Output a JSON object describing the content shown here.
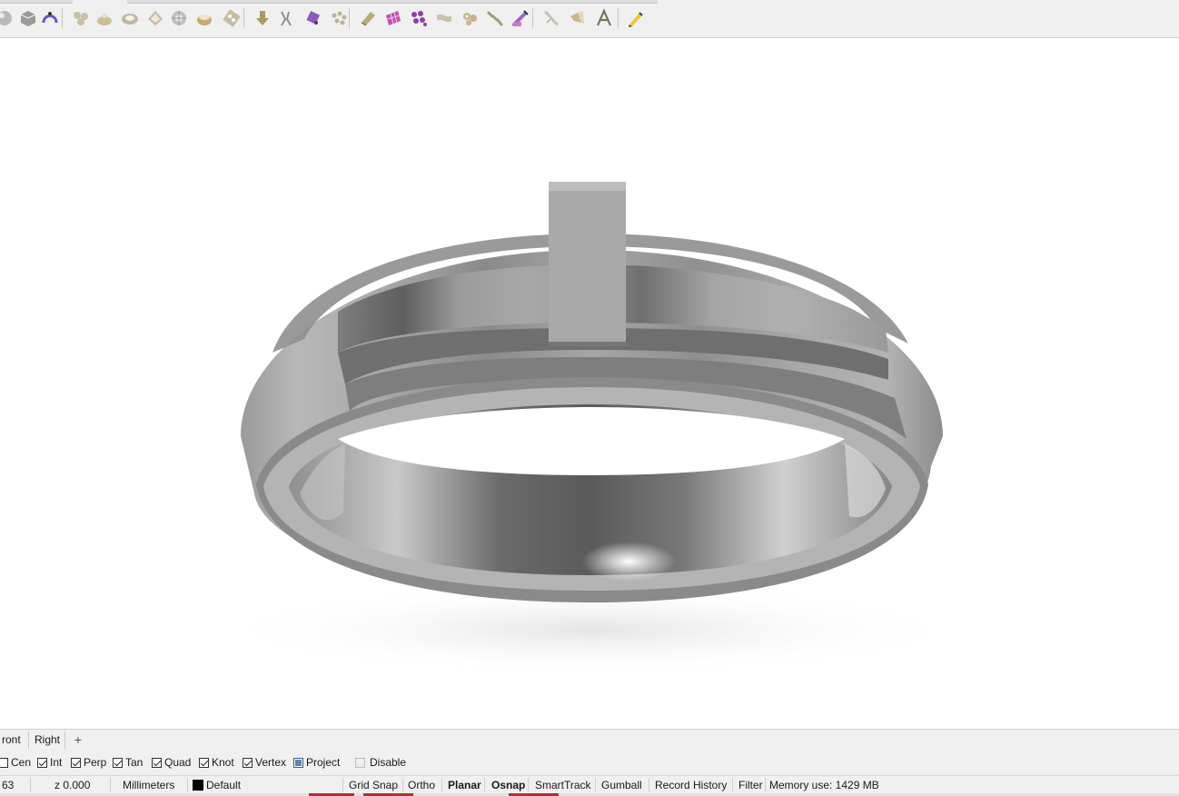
{
  "toolbar": {
    "tools": [
      {
        "icon": "sphere-partial-icon",
        "color": "#b8b8b8"
      },
      {
        "icon": "box-shade-icon",
        "color": "#9a9a9a"
      },
      {
        "icon": "bend-arc-icon",
        "color": "#6b56c8"
      },
      {
        "icon": "gem-cluster-icon",
        "color": "#c9c0a8"
      },
      {
        "icon": "ring-setting-icon",
        "color": "#cdbf94"
      },
      {
        "icon": "bezel-icon",
        "color": "#bfb6a0"
      },
      {
        "icon": "pear-gem-icon",
        "color": "#c4bba6"
      },
      {
        "icon": "round-gem-icon",
        "color": "#c0c0c0"
      },
      {
        "icon": "cup-bezel-icon",
        "color": "#c8a878"
      },
      {
        "icon": "gem-row-icon",
        "color": "#c6bc9f"
      },
      {
        "icon": "drop-arrow-icon",
        "color": "#a89a66"
      },
      {
        "icon": "claw-prong-icon",
        "color": "#8f8f8f"
      },
      {
        "icon": "cutter-icon",
        "color": "#8a5bc0"
      },
      {
        "icon": "pave-scatter-icon",
        "color": "#bcb497"
      },
      {
        "icon": "extrude-bar-icon",
        "color": "#b7aa7a"
      },
      {
        "icon": "mesh-grid-icon",
        "color": "#c050b5"
      },
      {
        "icon": "bead-grid-icon",
        "color": "#8e3fa6"
      },
      {
        "icon": "ribbon-icon",
        "color": "#c9c3ad"
      },
      {
        "icon": "gear-cluster-icon",
        "color": "#c4b58a"
      },
      {
        "icon": "chain-link-icon",
        "color": "#a59a79"
      },
      {
        "icon": "wand-purple-icon",
        "color": "#9a66c9"
      },
      {
        "icon": "loupe-curve-icon",
        "color": "#c7c1b2"
      },
      {
        "icon": "megaphone-icon",
        "color": "#c9b68a"
      },
      {
        "icon": "text-a-icon",
        "color": "#7a7360"
      },
      {
        "icon": "pencil-icon",
        "color": "#444444"
      }
    ]
  },
  "viewport": {
    "tabs": [
      "ront",
      "Right"
    ],
    "add_tab_icon": "plus-icon"
  },
  "osnap": {
    "items": [
      {
        "label": "Cen",
        "state": "unchecked"
      },
      {
        "label": "Int",
        "state": "checked"
      },
      {
        "label": "Perp",
        "state": "checked"
      },
      {
        "label": "Tan",
        "state": "checked"
      },
      {
        "label": "Quad",
        "state": "checked"
      },
      {
        "label": "Knot",
        "state": "checked"
      },
      {
        "label": "Vertex",
        "state": "checked"
      },
      {
        "label": "Project",
        "state": "filled"
      },
      {
        "label": "Disable",
        "state": "disabled"
      }
    ]
  },
  "statusbar": {
    "coord_fragment": "63",
    "z_value": "z 0.000",
    "units": "Millimeters",
    "layer": "Default",
    "layer_color": "#000000",
    "buttons": [
      {
        "label": "Grid Snap",
        "bold": false
      },
      {
        "label": "Ortho",
        "bold": false
      },
      {
        "label": "Planar",
        "bold": true
      },
      {
        "label": "Osnap",
        "bold": true
      },
      {
        "label": "SmartTrack",
        "bold": false
      },
      {
        "label": "Gumball",
        "bold": false
      },
      {
        "label": "Record History",
        "bold": false
      },
      {
        "label": "Filter",
        "bold": false
      }
    ],
    "memory": "Memory use: 1429 MB"
  },
  "colors": {
    "chrome_bg": "#f0f0f0",
    "viewport_bg": "#ffffff",
    "ring_metal": "#9c9c9c",
    "taskbar_accent": "#b5302a"
  }
}
